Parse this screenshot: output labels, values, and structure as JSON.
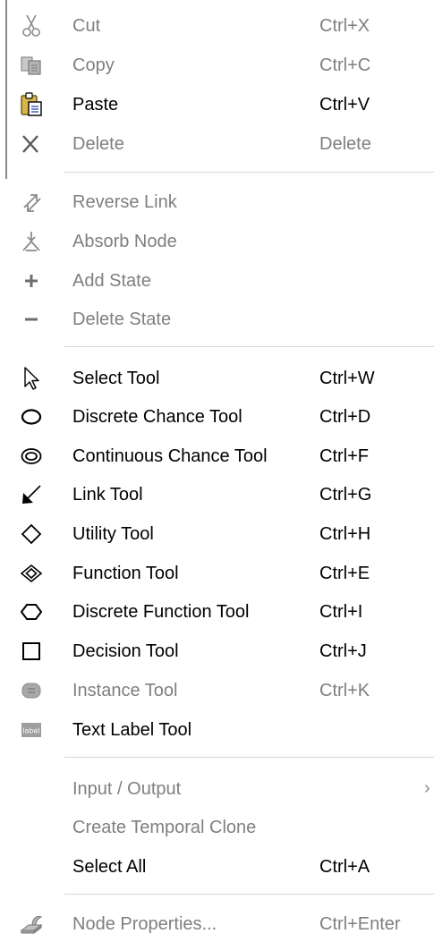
{
  "context_menu": {
    "items": [
      {
        "label": "Cut",
        "shortcut": "Ctrl+X",
        "icon": "scissors-icon",
        "enabled": false
      },
      {
        "label": "Copy",
        "shortcut": "Ctrl+C",
        "icon": "copy-icon",
        "enabled": false
      },
      {
        "label": "Paste",
        "shortcut": "Ctrl+V",
        "icon": "clipboard-icon",
        "enabled": true
      },
      {
        "label": "Delete",
        "shortcut": "Delete",
        "icon": "x-icon",
        "enabled": false
      },
      {
        "label": "Reverse Link",
        "shortcut": "",
        "icon": "reverse-link-icon",
        "enabled": false
      },
      {
        "label": "Absorb Node",
        "shortcut": "",
        "icon": "absorb-node-icon",
        "enabled": false
      },
      {
        "label": "Add State",
        "shortcut": "",
        "icon": "plus-icon",
        "enabled": false
      },
      {
        "label": "Delete State",
        "shortcut": "",
        "icon": "minus-icon",
        "enabled": false
      },
      {
        "label": "Select Tool",
        "shortcut": "Ctrl+W",
        "icon": "cursor-arrow-icon",
        "enabled": true
      },
      {
        "label": "Discrete Chance Tool",
        "shortcut": "Ctrl+D",
        "icon": "oval-icon",
        "enabled": true
      },
      {
        "label": "Continuous Chance Tool",
        "shortcut": "Ctrl+F",
        "icon": "double-oval-icon",
        "enabled": true
      },
      {
        "label": "Link Tool",
        "shortcut": "Ctrl+G",
        "icon": "link-arrow-icon",
        "enabled": true
      },
      {
        "label": "Utility Tool",
        "shortcut": "Ctrl+H",
        "icon": "diamond-icon",
        "enabled": true
      },
      {
        "label": "Function Tool",
        "shortcut": "Ctrl+E",
        "icon": "double-diamond-icon",
        "enabled": true
      },
      {
        "label": "Discrete Function Tool",
        "shortcut": "Ctrl+I",
        "icon": "hexagon-icon",
        "enabled": true
      },
      {
        "label": "Decision Tool",
        "shortcut": "Ctrl+J",
        "icon": "square-icon",
        "enabled": true
      },
      {
        "label": "Instance Tool",
        "shortcut": "Ctrl+K",
        "icon": "instance-icon",
        "enabled": false
      },
      {
        "label": "Text Label Tool",
        "shortcut": "",
        "icon": "label-icon",
        "icon_text": "label",
        "enabled": true
      },
      {
        "label": "Input / Output",
        "shortcut": "",
        "icon": "",
        "enabled": false,
        "submenu_arrow": "›"
      },
      {
        "label": "Create Temporal Clone",
        "shortcut": "",
        "icon": "",
        "enabled": false
      },
      {
        "label": "Select All",
        "shortcut": "Ctrl+A",
        "icon": "",
        "enabled": true
      },
      {
        "label": "Node Properties...",
        "shortcut": "Ctrl+Enter",
        "icon": "node-properties-icon",
        "enabled": false
      }
    ]
  }
}
